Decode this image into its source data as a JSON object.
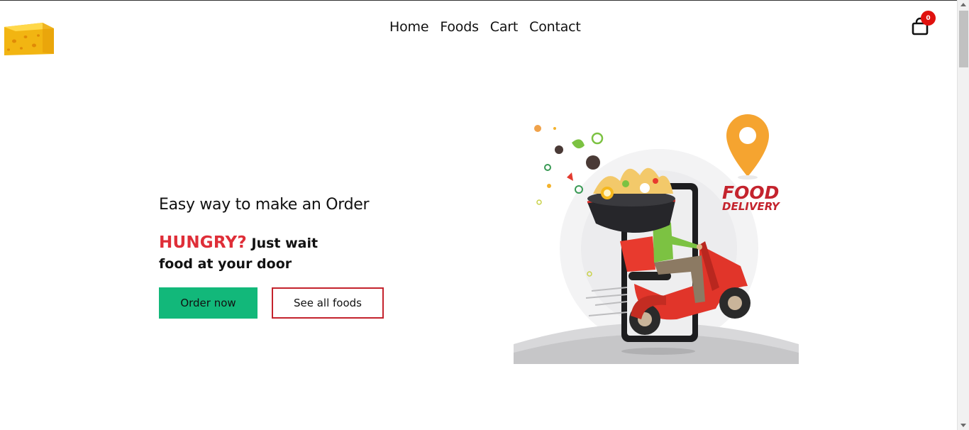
{
  "header": {
    "logo_icon": "cheese-icon",
    "nav": [
      {
        "label": "Home"
      },
      {
        "label": "Foods"
      },
      {
        "label": "Cart"
      },
      {
        "label": "Contact"
      }
    ],
    "cart_icon": "shopping-bag-icon",
    "cart_count": "0"
  },
  "hero": {
    "subtitle": "Easy way to make an Order",
    "headline_highlight": "HUNGRY?",
    "headline_rest_1": "Just wait",
    "headline_rest_2": "food at your door",
    "order_button": "Order now",
    "see_all_button": "See all foods",
    "illustration": {
      "text_1": "FOOD",
      "text_2": "DELIVERY"
    }
  },
  "colors": {
    "accent_green": "#12b87a",
    "accent_red": "#df2e38",
    "badge_red": "#e0110e",
    "border_red": "#c4232d"
  }
}
